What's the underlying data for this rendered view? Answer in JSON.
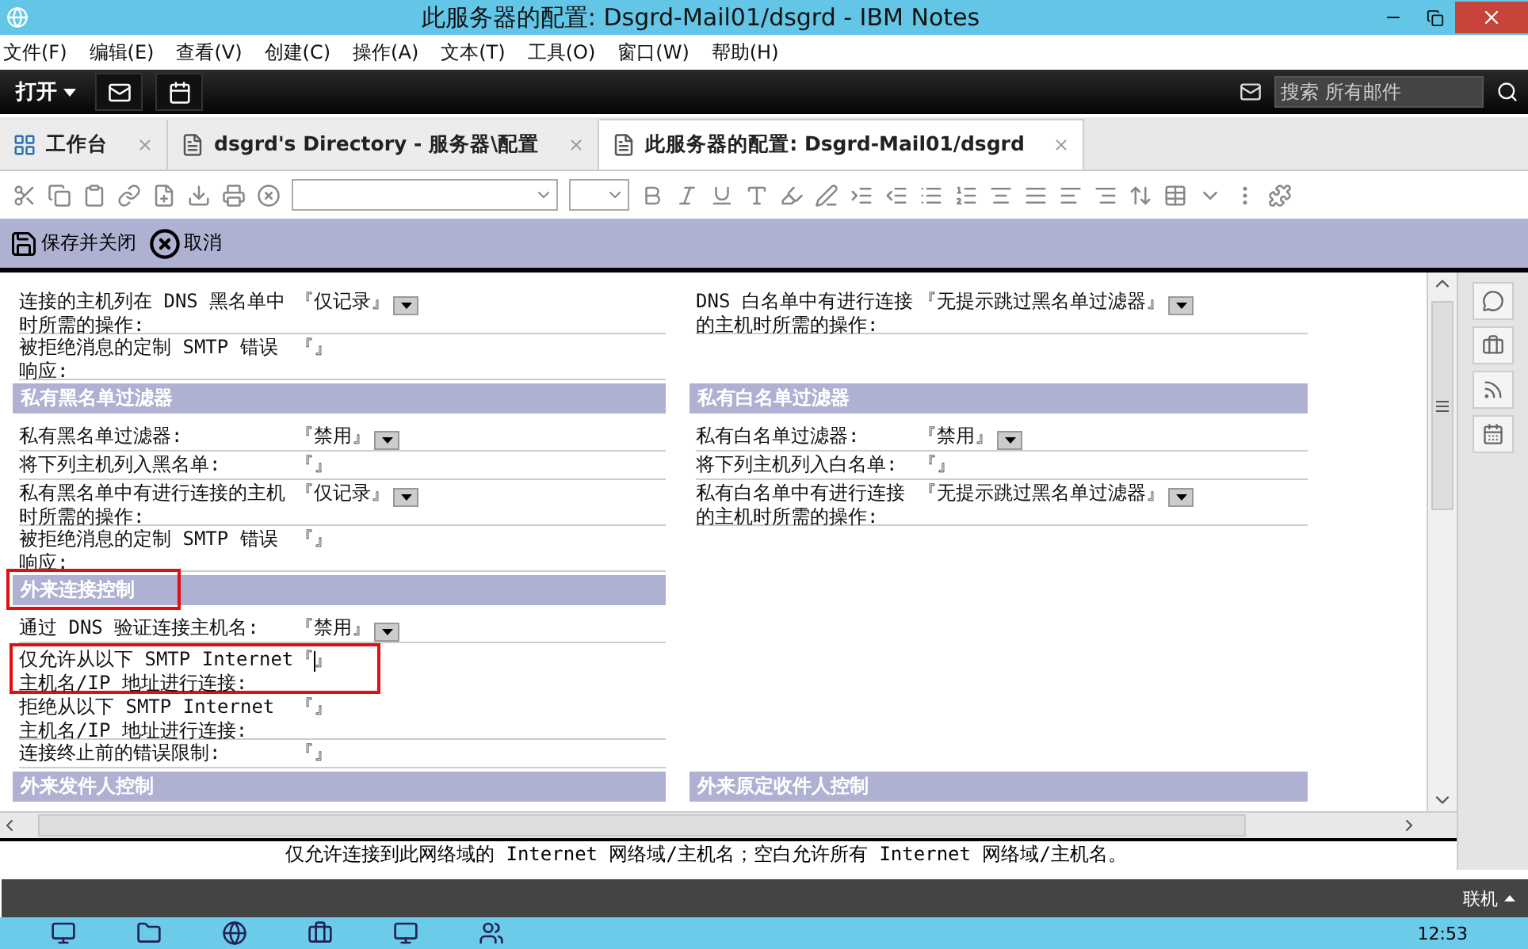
{
  "window": {
    "title": "此服务器的配置: Dsgrd-Mail01/dsgrd - IBM Notes"
  },
  "menu": [
    "文件(F)",
    "编辑(E)",
    "查看(V)",
    "创建(C)",
    "操作(A)",
    "文本(T)",
    "工具(O)",
    "窗口(W)",
    "帮助(H)"
  ],
  "topbar": {
    "open_label": "打开",
    "search_placeholder": "搜索 所有邮件"
  },
  "tabs": [
    {
      "label": "工作台",
      "kind": "workspace",
      "selected": false
    },
    {
      "label": "dsgrd's Directory - 服务器\\配置",
      "kind": "document",
      "selected": false
    },
    {
      "label": "此服务器的配置: Dsgrd-Mail01/dsgrd",
      "kind": "document",
      "selected": true
    }
  ],
  "actions": [
    {
      "label": "保存并关闭",
      "kind": "save"
    },
    {
      "label": "取消",
      "kind": "cancel"
    }
  ],
  "form": [
    {
      "left": {
        "kind": "row",
        "label": "连接的主机列在 DNS 黑名单中时所需的操作:",
        "value": "『仅记录』",
        "dropdown": true
      },
      "right": {
        "kind": "row",
        "label": "DNS 白名单中有进行连接的主机时所需的操作:",
        "value": "『无提示跳过黑名单过滤器』",
        "dropdown": true
      }
    },
    {
      "left": {
        "kind": "row",
        "label": "被拒绝消息的定制 SMTP 错误响应:",
        "value": "『』",
        "dropdown": false
      }
    },
    {
      "left": {
        "kind": "section",
        "label": "私有黑名单过滤器",
        "highlighted": false
      },
      "right": {
        "kind": "section",
        "label": "私有白名单过滤器",
        "highlighted": false
      }
    },
    {
      "left": {
        "kind": "row",
        "label": "私有黑名单过滤器:",
        "value": "『禁用』",
        "dropdown": true
      },
      "right": {
        "kind": "row",
        "label": "私有白名单过滤器:",
        "value": "『禁用』",
        "dropdown": true
      }
    },
    {
      "left": {
        "kind": "row",
        "label": "将下列主机列入黑名单:",
        "value": "『』",
        "dropdown": false
      },
      "right": {
        "kind": "row",
        "label": "将下列主机列入白名单:",
        "value": "『』",
        "dropdown": false
      }
    },
    {
      "left": {
        "kind": "row",
        "label": "私有黑名单中有进行连接的主机时所需的操作:",
        "value": "『仅记录』",
        "dropdown": true
      },
      "right": {
        "kind": "row",
        "label": "私有白名单中有进行连接的主机时所需的操作:",
        "value": "『无提示跳过黑名单过滤器』",
        "dropdown": true
      }
    },
    {
      "left": {
        "kind": "row",
        "label": "被拒绝消息的定制 SMTP 错误响应:",
        "value": "『』",
        "dropdown": false
      }
    },
    {
      "left": {
        "kind": "section",
        "label": "外来连接控制",
        "highlighted": true
      }
    },
    {
      "left": {
        "kind": "row",
        "label": "通过 DNS 验证连接主机名:",
        "value": "『禁用』",
        "dropdown": true
      }
    },
    {
      "left": {
        "kind": "row",
        "label": "仅允许从以下 SMTP Internet 主机名/IP 地址进行连接:",
        "value": "『』",
        "dropdown": false,
        "focused": true,
        "highlighted": true
      }
    },
    {
      "left": {
        "kind": "row",
        "label": "拒绝从以下 SMTP Internet 主机名/IP 地址进行连接:",
        "value": "『』",
        "dropdown": false
      }
    },
    {
      "left": {
        "kind": "row",
        "label": "连接终止前的错误限制:",
        "value": "『』",
        "dropdown": false
      }
    },
    {
      "left": {
        "kind": "section",
        "label": "外来发件人控制",
        "highlighted": false
      },
      "right": {
        "kind": "section",
        "label": "外来原定收件人控制",
        "highlighted": false
      }
    }
  ],
  "status_text": "仅允许连接到此网络域的 Internet 网络域/主机名；空白允许所有 Internet 网络域/主机名。",
  "status_bar": {
    "state": "联机"
  },
  "taskbar": {
    "time": "12:53"
  }
}
